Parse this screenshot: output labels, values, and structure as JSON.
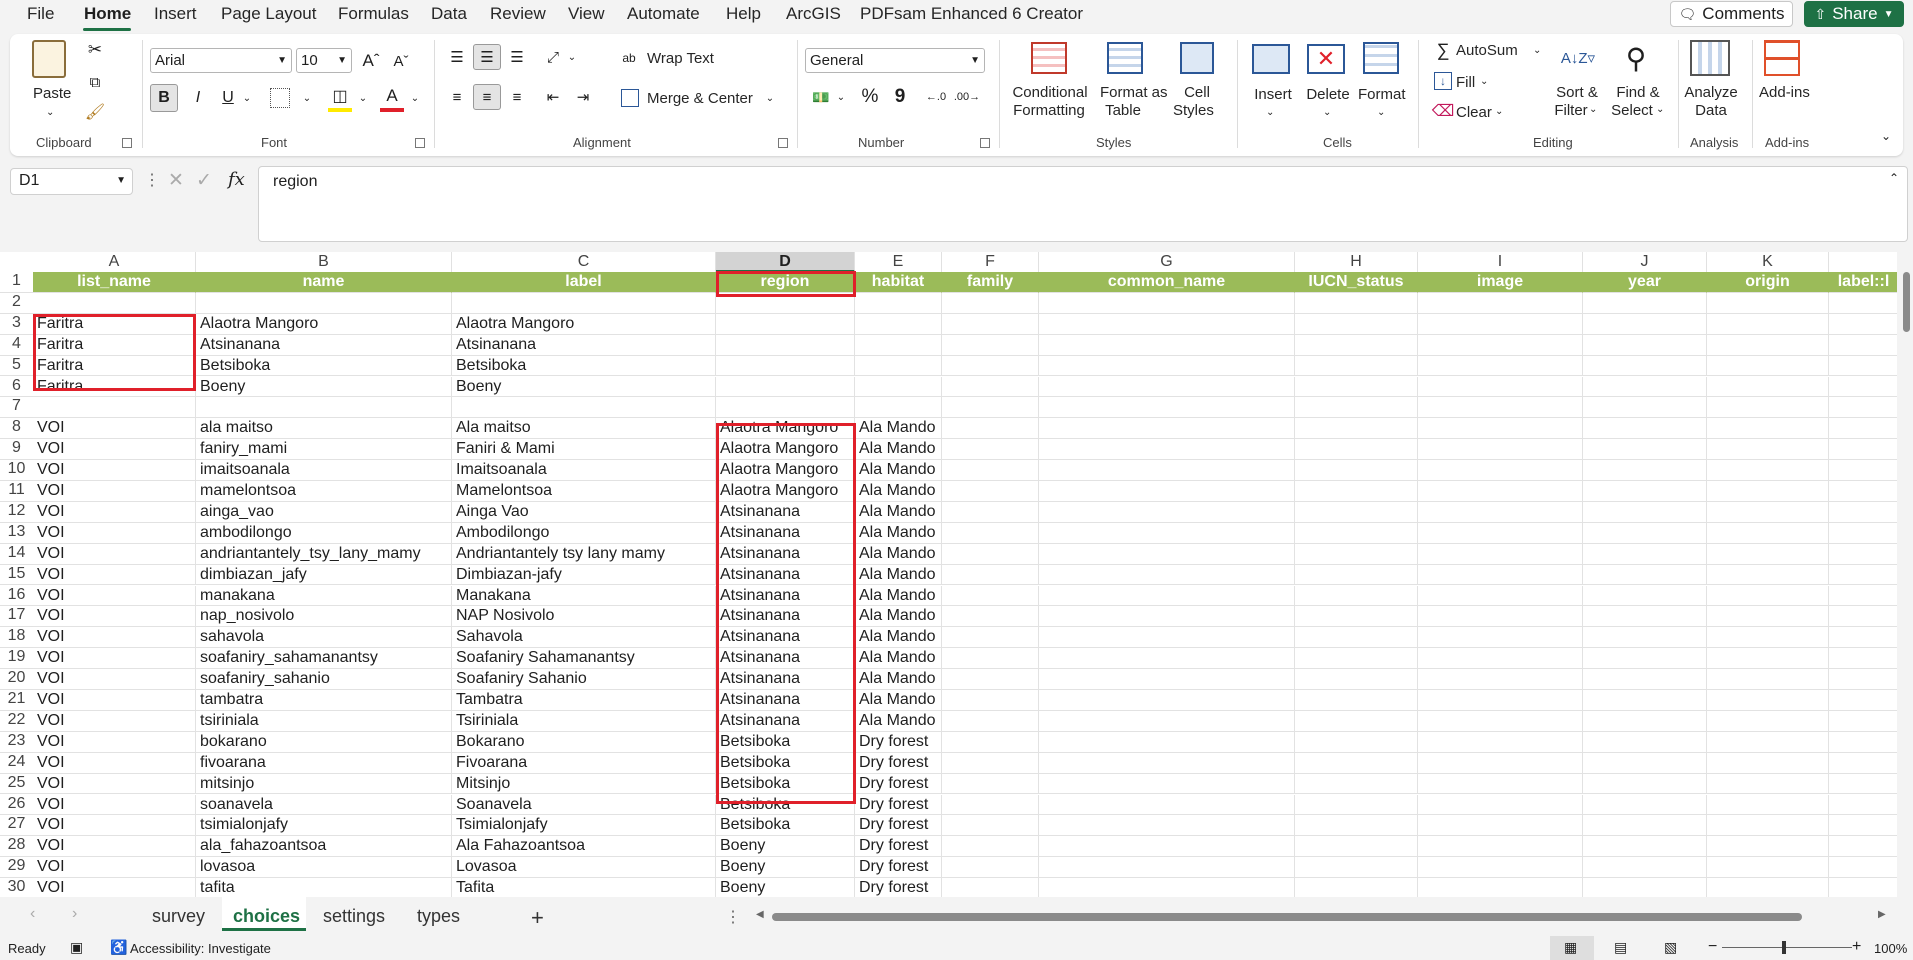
{
  "menu": {
    "items": [
      "File",
      "Home",
      "Insert",
      "Page Layout",
      "Formulas",
      "Data",
      "Review",
      "View",
      "Automate",
      "Help",
      "ArcGIS",
      "PDFsam Enhanced 6 Creator"
    ],
    "comments": "Comments",
    "share": "Share"
  },
  "ribbon": {
    "clipboard": {
      "paste": "Paste",
      "label": "Clipboard"
    },
    "font": {
      "name": "Arial",
      "size": "10",
      "bold": "B",
      "italic": "I",
      "underline": "U",
      "label": "Font"
    },
    "alignment": {
      "wrap": "Wrap Text",
      "merge": "Merge & Center",
      "label": "Alignment"
    },
    "number": {
      "format": "General",
      "percent": "%",
      "comma": "9",
      "label": "Number"
    },
    "styles": {
      "conditional": [
        "Conditional",
        "Formatting"
      ],
      "format_table": [
        "Format as",
        "Table"
      ],
      "cell_styles": [
        "Cell",
        "Styles"
      ],
      "label": "Styles"
    },
    "cells": {
      "insert": "Insert",
      "delete": "Delete",
      "format": "Format",
      "label": "Cells"
    },
    "editing": {
      "autosum": "AutoSum",
      "fill": "Fill",
      "clear": "Clear",
      "sort": [
        "Sort &",
        "Filter"
      ],
      "find": [
        "Find &",
        "Select"
      ],
      "label": "Editing"
    },
    "analysis": {
      "analyze": [
        "Analyze",
        "Data"
      ],
      "label": "Analysis"
    },
    "addins": {
      "addins": "Add-ins",
      "label": "Add-ins"
    }
  },
  "formula_bar": {
    "cell_ref": "D1",
    "fx": "fx",
    "content": "region"
  },
  "grid": {
    "columns": [
      "A",
      "B",
      "C",
      "D",
      "E",
      "F",
      "G",
      "H",
      "I",
      "J",
      "K"
    ],
    "selected_column": "D",
    "header_row": [
      "list_name",
      "name",
      "label",
      "region",
      "habitat",
      "family",
      "common_name",
      "IUCN_status",
      "image",
      "year",
      "origin",
      "label::l"
    ],
    "rows": [
      {
        "n": "1"
      },
      {
        "n": "2",
        "cells": [
          "",
          "",
          "",
          "",
          ""
        ]
      },
      {
        "n": "3",
        "cells": [
          "Faritra",
          "Alaotra Mangoro",
          "Alaotra Mangoro",
          "",
          ""
        ]
      },
      {
        "n": "4",
        "cells": [
          "Faritra",
          "Atsinanana",
          "Atsinanana",
          "",
          ""
        ]
      },
      {
        "n": "5",
        "cells": [
          "Faritra",
          "Betsiboka",
          "Betsiboka",
          "",
          ""
        ]
      },
      {
        "n": "6",
        "cells": [
          "Faritra",
          "Boeny",
          "Boeny",
          "",
          ""
        ]
      },
      {
        "n": "7",
        "cells": [
          "",
          "",
          "",
          "",
          ""
        ]
      },
      {
        "n": "8",
        "cells": [
          "VOI",
          "ala maitso",
          "Ala maitso",
          "Alaotra Mangoro",
          "Ala Mando"
        ]
      },
      {
        "n": "9",
        "cells": [
          "VOI",
          "faniry_mami",
          "Faniri & Mami",
          "Alaotra Mangoro",
          "Ala Mando"
        ]
      },
      {
        "n": "10",
        "cells": [
          "VOI",
          "imaitsoanala",
          "Imaitsoanala",
          "Alaotra Mangoro",
          "Ala Mando"
        ]
      },
      {
        "n": "11",
        "cells": [
          "VOI",
          "mamelontsoa",
          "Mamelontsoa",
          "Alaotra Mangoro",
          "Ala Mando"
        ]
      },
      {
        "n": "12",
        "cells": [
          "VOI",
          "ainga_vao",
          "Ainga Vao",
          "Atsinanana",
          "Ala Mando"
        ]
      },
      {
        "n": "13",
        "cells": [
          "VOI",
          "ambodilongo",
          "Ambodilongo",
          "Atsinanana",
          "Ala Mando"
        ]
      },
      {
        "n": "14",
        "cells": [
          "VOI",
          "andriantantely_tsy_lany_mamy",
          "Andriantantely tsy lany mamy",
          "Atsinanana",
          "Ala Mando"
        ]
      },
      {
        "n": "15",
        "cells": [
          "VOI",
          "dimbiazan_jafy",
          "Dimbiazan-jafy",
          "Atsinanana",
          "Ala Mando"
        ]
      },
      {
        "n": "16",
        "cells": [
          "VOI",
          "manakana",
          "Manakana",
          "Atsinanana",
          "Ala Mando"
        ]
      },
      {
        "n": "17",
        "cells": [
          "VOI",
          "nap_nosivolo",
          "NAP Nosivolo",
          "Atsinanana",
          "Ala Mando"
        ]
      },
      {
        "n": "18",
        "cells": [
          "VOI",
          "sahavola",
          "Sahavola",
          "Atsinanana",
          "Ala Mando"
        ]
      },
      {
        "n": "19",
        "cells": [
          "VOI",
          "soafaniry_sahamanantsy",
          "Soafaniry Sahamanantsy",
          "Atsinanana",
          "Ala Mando"
        ]
      },
      {
        "n": "20",
        "cells": [
          "VOI",
          "soafaniry_sahanio",
          "Soafaniry Sahanio",
          "Atsinanana",
          "Ala Mando"
        ]
      },
      {
        "n": "21",
        "cells": [
          "VOI",
          "tambatra",
          "Tambatra",
          "Atsinanana",
          "Ala Mando"
        ]
      },
      {
        "n": "22",
        "cells": [
          "VOI",
          "tsiriniala",
          "Tsiriniala",
          "Atsinanana",
          "Ala Mando"
        ]
      },
      {
        "n": "23",
        "cells": [
          "VOI",
          "bokarano",
          "Bokarano",
          "Betsiboka",
          "Dry forest"
        ]
      },
      {
        "n": "24",
        "cells": [
          "VOI",
          "fivoarana",
          "Fivoarana",
          "Betsiboka",
          "Dry forest"
        ]
      },
      {
        "n": "25",
        "cells": [
          "VOI",
          "mitsinjo",
          "Mitsinjo",
          "Betsiboka",
          "Dry forest"
        ]
      },
      {
        "n": "26",
        "cells": [
          "VOI",
          "soanavela",
          "Soanavela",
          "Betsiboka",
          "Dry forest"
        ]
      },
      {
        "n": "27",
        "cells": [
          "VOI",
          "tsimialonjafy",
          "Tsimialonjafy",
          "Betsiboka",
          "Dry forest"
        ]
      },
      {
        "n": "28",
        "cells": [
          "VOI",
          "ala_fahazoantsoa",
          "Ala Fahazoantsoa",
          "Boeny",
          "Dry forest"
        ]
      },
      {
        "n": "29",
        "cells": [
          "VOI",
          "lovasoa",
          "Lovasoa",
          "Boeny",
          "Dry forest"
        ]
      },
      {
        "n": "30",
        "cells": [
          "VOI",
          "tafita",
          "Tafita",
          "Boeny",
          "Dry forest"
        ]
      }
    ]
  },
  "sheets": {
    "tabs": [
      "survey",
      "choices",
      "settings",
      "types"
    ],
    "active": "choices",
    "add": "+"
  },
  "status": {
    "ready": "Ready",
    "accessibility": "Accessibility: Investigate",
    "zoom": "100%"
  },
  "colors": {
    "header_fill": "#9bbb59",
    "accent": "#1e7145",
    "highlight": "#e0202a"
  }
}
